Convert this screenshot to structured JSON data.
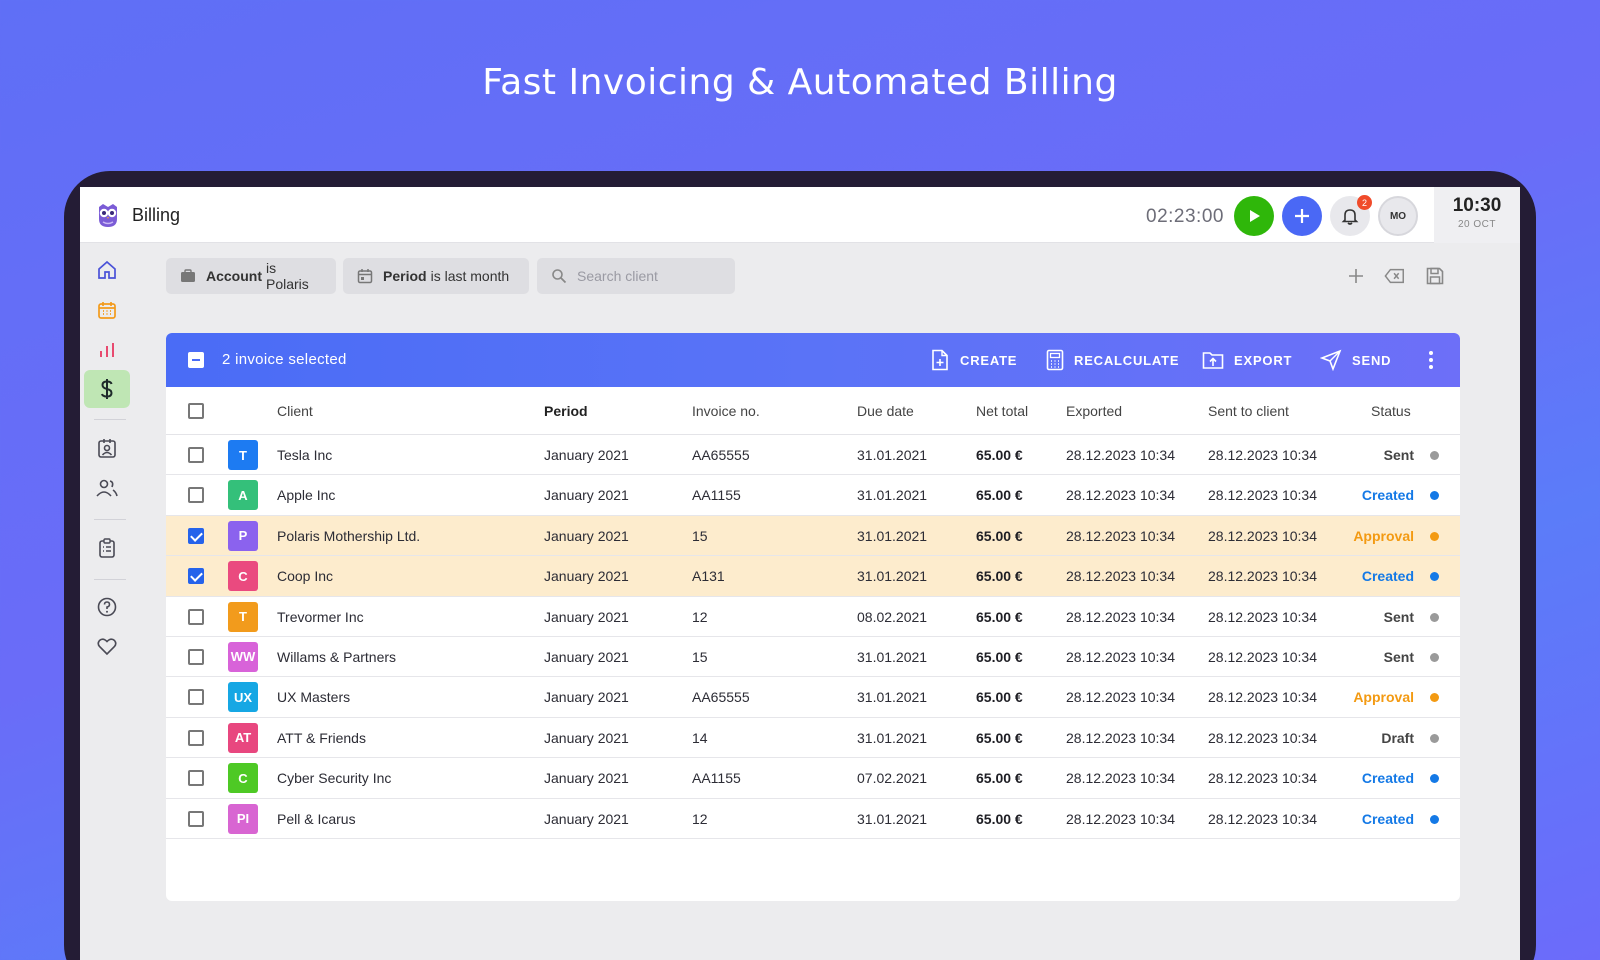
{
  "headline": "Fast Invoicing & Automated Billing",
  "app": {
    "title": "Billing",
    "timer": "02:23:00",
    "notifications": "2",
    "user_initials": "MO",
    "clock_time": "10:30",
    "clock_date": "20 OCT"
  },
  "filters": {
    "account_label": "Account",
    "account_value": "is Polaris",
    "period_label": "Period",
    "period_value": "is last month",
    "search_placeholder": "Search client"
  },
  "actionbar": {
    "selection_text": "2 invoice selected",
    "create": "CREATE",
    "recalculate": "RECALCULATE",
    "export": "EXPORT",
    "send": "SEND"
  },
  "columns": {
    "client": "Client",
    "period": "Period",
    "invoice_no": "Invoice no.",
    "due_date": "Due date",
    "net_total": "Net total",
    "exported": "Exported",
    "sent_to_client": "Sent to client",
    "status": "Status"
  },
  "colors": {
    "accent": "#4a6cf6",
    "sent": "#555555",
    "created": "#1479e6",
    "approval": "#f39a12",
    "draft": "#555555",
    "dot_grey": "#9a9a9a",
    "dot_blue": "#1479e6",
    "dot_orange": "#f39a12"
  },
  "rows": [
    {
      "initials": "T",
      "avatar_color": "#1d7bf2",
      "client": "Tesla Inc",
      "period": "January 2021",
      "invoice_no": "AA65555",
      "due_date": "31.01.2021",
      "net_total": "65.00 €",
      "exported": "28.12.2023 10:34",
      "sent": "28.12.2023 10:34",
      "status": "Sent",
      "status_color": "#444444",
      "dot_color": "#9a9a9a",
      "selected": false
    },
    {
      "initials": "A",
      "avatar_color": "#34c07a",
      "client": "Apple Inc",
      "period": "January 2021",
      "invoice_no": "AA1155",
      "due_date": "31.01.2021",
      "net_total": "65.00 €",
      "exported": "28.12.2023 10:34",
      "sent": "28.12.2023 10:34",
      "status": "Created",
      "status_color": "#1479e6",
      "dot_color": "#1479e6",
      "selected": false
    },
    {
      "initials": "P",
      "avatar_color": "#8b62ee",
      "client": "Polaris Mothership Ltd.",
      "period": "January 2021",
      "invoice_no": "15",
      "due_date": "31.01.2021",
      "net_total": "65.00 €",
      "exported": "28.12.2023 10:34",
      "sent": "28.12.2023 10:34",
      "status": "Approval",
      "status_color": "#f39a12",
      "dot_color": "#f39a12",
      "selected": true
    },
    {
      "initials": "C",
      "avatar_color": "#ea4a7f",
      "client": "Coop Inc",
      "period": "January 2021",
      "invoice_no": "A131",
      "due_date": "31.01.2021",
      "net_total": "65.00 €",
      "exported": "28.12.2023 10:34",
      "sent": "28.12.2023 10:34",
      "status": "Created",
      "status_color": "#1479e6",
      "dot_color": "#1479e6",
      "selected": true
    },
    {
      "initials": "T",
      "avatar_color": "#f29b1c",
      "client": "Trevormer Inc",
      "period": "January 2021",
      "invoice_no": "12",
      "due_date": "08.02.2021",
      "net_total": "65.00 €",
      "exported": "28.12.2023 10:34",
      "sent": "28.12.2023 10:34",
      "status": "Sent",
      "status_color": "#444444",
      "dot_color": "#9a9a9a",
      "selected": false
    },
    {
      "initials": "WW",
      "avatar_color": "#d863d9",
      "client": "Willams & Partners",
      "period": "January 2021",
      "invoice_no": "15",
      "due_date": "31.01.2021",
      "net_total": "65.00 €",
      "exported": "28.12.2023 10:34",
      "sent": "28.12.2023 10:34",
      "status": "Sent",
      "status_color": "#444444",
      "dot_color": "#9a9a9a",
      "selected": false
    },
    {
      "initials": "UX",
      "avatar_color": "#16a7e4",
      "client": "UX Masters",
      "period": "January 2021",
      "invoice_no": "AA65555",
      "due_date": "31.01.2021",
      "net_total": "65.00 €",
      "exported": "28.12.2023 10:34",
      "sent": "28.12.2023 10:34",
      "status": "Approval",
      "status_color": "#f39a12",
      "dot_color": "#f39a12",
      "selected": false
    },
    {
      "initials": "AT",
      "avatar_color": "#e8477f",
      "client": "ATT & Friends",
      "period": "January 2021",
      "invoice_no": "14",
      "due_date": "31.01.2021",
      "net_total": "65.00 €",
      "exported": "28.12.2023 10:34",
      "sent": "28.12.2023 10:34",
      "status": "Draft",
      "status_color": "#444444",
      "dot_color": "#9a9a9a",
      "selected": false
    },
    {
      "initials": "C",
      "avatar_color": "#4ec925",
      "client": "Cyber Security Inc",
      "period": "January 2021",
      "invoice_no": "AA1155",
      "due_date": "07.02.2021",
      "net_total": "65.00 €",
      "exported": "28.12.2023 10:34",
      "sent": "28.12.2023 10:34",
      "status": "Created",
      "status_color": "#1479e6",
      "dot_color": "#1479e6",
      "selected": false
    },
    {
      "initials": "PI",
      "avatar_color": "#d865d2",
      "client": "Pell & Icarus",
      "period": "January 2021",
      "invoice_no": "12",
      "due_date": "31.01.2021",
      "net_total": "65.00 €",
      "exported": "28.12.2023 10:34",
      "sent": "28.12.2023 10:34",
      "status": "Created",
      "status_color": "#1479e6",
      "dot_color": "#1479e6",
      "selected": false
    }
  ]
}
